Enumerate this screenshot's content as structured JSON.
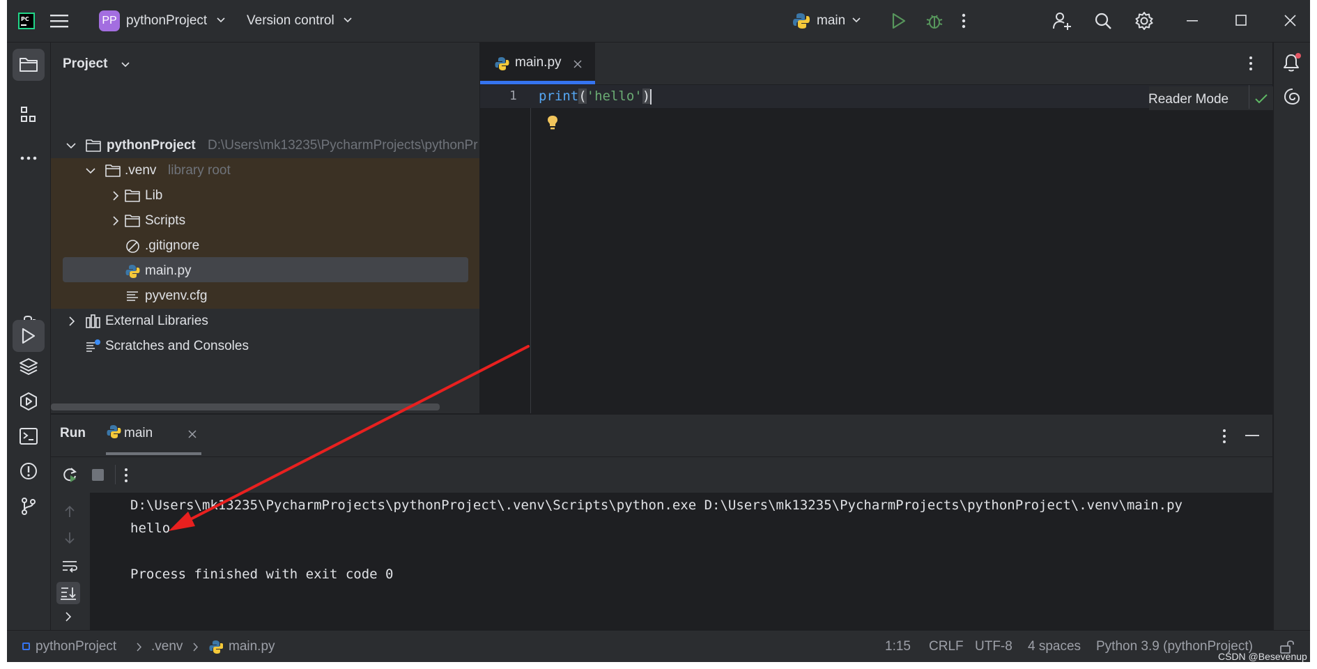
{
  "titlebar": {
    "app_icon": "pycharm-logo",
    "project_badge": "PP",
    "project_name": "pythonProject",
    "vcs_label": "Version control",
    "run_config": "main",
    "colors": {
      "badge": "#a36ee0",
      "run": "#57965c",
      "debug": "#57965c"
    }
  },
  "project_panel": {
    "title": "Project",
    "tree": [
      {
        "label": "pythonProject",
        "sub": "D:\\Users\\mk13235\\PycharmProjects\\pythonPr",
        "icon": "folder-icon"
      },
      {
        "label": ".venv",
        "sub": "library root",
        "icon": "folder-icon"
      },
      {
        "label": "Lib",
        "icon": "folder-icon"
      },
      {
        "label": "Scripts",
        "icon": "folder-icon"
      },
      {
        "label": ".gitignore",
        "icon": "ignore-icon"
      },
      {
        "label": "main.py",
        "icon": "python-file-icon"
      },
      {
        "label": "pyvenv.cfg",
        "icon": "text-file-icon"
      },
      {
        "label": "External Libraries",
        "icon": "library-icon"
      },
      {
        "label": "Scratches and Consoles",
        "icon": "scratches-icon"
      }
    ]
  },
  "editor": {
    "tab_label": "main.py",
    "line_number": "1",
    "code": {
      "func": "print",
      "open": "(",
      "string": "'hello'",
      "close": ")"
    },
    "reader_mode": "Reader Mode",
    "colors": {
      "func": "#56a8f5",
      "string": "#6aab73",
      "active_tab_underline": "#3574f0"
    }
  },
  "run_panel": {
    "title": "Run",
    "tab_label": "main",
    "console": [
      "D:\\Users\\mk13235\\PycharmProjects\\pythonProject\\.venv\\Scripts\\python.exe D:\\Users\\mk13235\\PycharmProjects\\pythonProject\\.venv\\main.py",
      "hello",
      "",
      "Process finished with exit code 0"
    ]
  },
  "statusbar": {
    "breadcrumb": [
      "pythonProject",
      ".venv",
      "main.py"
    ],
    "position": "1:15",
    "line_ending": "CRLF",
    "encoding": "UTF-8",
    "indent": "4 spaces",
    "interpreter": "Python 3.9 (pythonProject)",
    "watermark": "CSDN @Besevenup"
  },
  "annotation": {
    "arrow_color": "#e8201f"
  }
}
